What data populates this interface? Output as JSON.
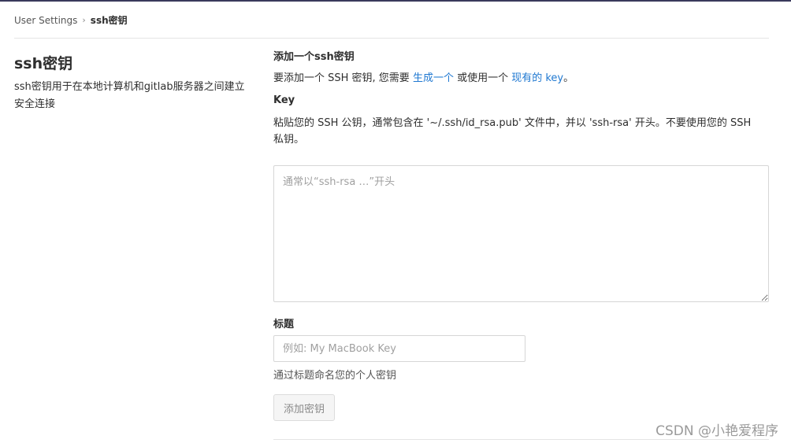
{
  "breadcrumb": {
    "parent": "User Settings",
    "separator": "›",
    "current": "ssh密钥"
  },
  "left": {
    "title": "ssh密钥",
    "description": "ssh密钥用于在本地计算机和gitlab服务器之间建立安全连接"
  },
  "form": {
    "section_title": "添加一个ssh密钥",
    "intro_prefix": "要添加一个 SSH 密钥, 您需要 ",
    "intro_link_generate": "生成一个",
    "intro_middle": " 或使用一个 ",
    "intro_link_existing": "现有的 key",
    "intro_suffix": "。",
    "key_label": "Key",
    "key_help": "粘贴您的 SSH 公钥，通常包含在 '~/.ssh/id_rsa.pub' 文件中，并以 'ssh-rsa' 开头。不要使用您的 SSH 私钥。",
    "key_placeholder": "通常以“ssh-rsa …”开头",
    "title_label": "标题",
    "title_placeholder": "例如: My MacBook Key",
    "title_help": "通过标题命名您的个人密钥",
    "submit_label": "添加密钥"
  },
  "watermark": "CSDN @小艳爱程序",
  "colors": {
    "link": "#1f78d1",
    "topbar": "#3a3a5c"
  }
}
